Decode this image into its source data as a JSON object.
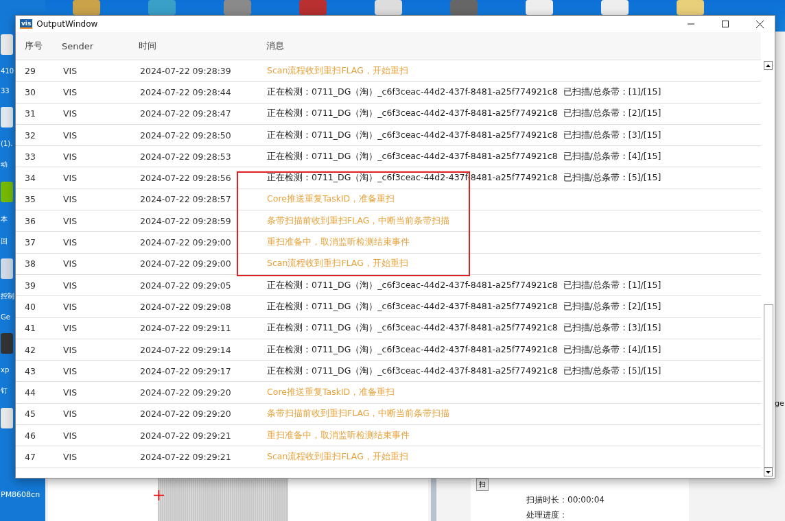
{
  "desktop": {
    "icon_labels": [
      "410",
      "33",
      "(1).",
      "动",
      "本",
      "回",
      "控制",
      "Ge",
      "xp",
      "钉",
      "PM8608cn"
    ]
  },
  "background_app": {
    "duration_label": "扫描时长：00:00:04",
    "progress_label": "处理进度：",
    "button_label": "扫",
    "side_text": "ge"
  },
  "window": {
    "title": "OutputWindow",
    "logo": "vis"
  },
  "table": {
    "columns": [
      "序号",
      "Sender",
      "时间",
      "消息"
    ],
    "rows": [
      {
        "index": "29",
        "sender": "VIS",
        "time": "2024-07-22 09:28:39",
        "message": "Scan流程收到重扫FLAG，开始重扫",
        "kind": "warn"
      },
      {
        "index": "30",
        "sender": "VIS",
        "time": "2024-07-22 09:28:44",
        "message": "正在检测：0711_DG（淘）_c6f3ceac-44d2-437f-8481-a25f774921c8  已扫描/总条带：[1]/[15]",
        "kind": "info"
      },
      {
        "index": "31",
        "sender": "VIS",
        "time": "2024-07-22 09:28:47",
        "message": "正在检测：0711_DG（淘）_c6f3ceac-44d2-437f-8481-a25f774921c8  已扫描/总条带：[2]/[15]",
        "kind": "info"
      },
      {
        "index": "32",
        "sender": "VIS",
        "time": "2024-07-22 09:28:50",
        "message": "正在检测：0711_DG（淘）_c6f3ceac-44d2-437f-8481-a25f774921c8  已扫描/总条带：[3]/[15]",
        "kind": "info"
      },
      {
        "index": "33",
        "sender": "VIS",
        "time": "2024-07-22 09:28:53",
        "message": "正在检测：0711_DG（淘）_c6f3ceac-44d2-437f-8481-a25f774921c8  已扫描/总条带：[4]/[15]",
        "kind": "info"
      },
      {
        "index": "34",
        "sender": "VIS",
        "time": "2024-07-22 09:28:56",
        "message": "正在检测：0711_DG（淘）_c6f3ceac-44d2-437f-8481-a25f774921c8  已扫描/总条带：[5]/[15]",
        "kind": "info"
      },
      {
        "index": "35",
        "sender": "VIS",
        "time": "2024-07-22 09:28:57",
        "message": "Core推送重复TaskID，准备重扫",
        "kind": "warn"
      },
      {
        "index": "36",
        "sender": "VIS",
        "time": "2024-07-22 09:28:59",
        "message": "条带扫描前收到重扫FLAG，中断当前条带扫描",
        "kind": "warn"
      },
      {
        "index": "37",
        "sender": "VIS",
        "time": "2024-07-22 09:29:00",
        "message": "重扫准备中，取消监听检测结束事件",
        "kind": "warn"
      },
      {
        "index": "38",
        "sender": "VIS",
        "time": "2024-07-22 09:29:00",
        "message": "Scan流程收到重扫FLAG，开始重扫",
        "kind": "warn"
      },
      {
        "index": "39",
        "sender": "VIS",
        "time": "2024-07-22 09:29:05",
        "message": "正在检测：0711_DG（淘）_c6f3ceac-44d2-437f-8481-a25f774921c8  已扫描/总条带：[1]/[15]",
        "kind": "info"
      },
      {
        "index": "40",
        "sender": "VIS",
        "time": "2024-07-22 09:29:08",
        "message": "正在检测：0711_DG（淘）_c6f3ceac-44d2-437f-8481-a25f774921c8  已扫描/总条带：[2]/[15]",
        "kind": "info"
      },
      {
        "index": "41",
        "sender": "VIS",
        "time": "2024-07-22 09:29:11",
        "message": "正在检测：0711_DG（淘）_c6f3ceac-44d2-437f-8481-a25f774921c8  已扫描/总条带：[3]/[15]",
        "kind": "info"
      },
      {
        "index": "42",
        "sender": "VIS",
        "time": "2024-07-22 09:29:14",
        "message": "正在检测：0711_DG（淘）_c6f3ceac-44d2-437f-8481-a25f774921c8  已扫描/总条带：[4]/[15]",
        "kind": "info"
      },
      {
        "index": "43",
        "sender": "VIS",
        "time": "2024-07-22 09:29:17",
        "message": "正在检测：0711_DG（淘）_c6f3ceac-44d2-437f-8481-a25f774921c8  已扫描/总条带：[5]/[15]",
        "kind": "info"
      },
      {
        "index": "44",
        "sender": "VIS",
        "time": "2024-07-22 09:29:20",
        "message": "Core推送重复TaskID，准备重扫",
        "kind": "warn"
      },
      {
        "index": "45",
        "sender": "VIS",
        "time": "2024-07-22 09:29:20",
        "message": "条带扫描前收到重扫FLAG，中断当前条带扫描",
        "kind": "warn"
      },
      {
        "index": "46",
        "sender": "VIS",
        "time": "2024-07-22 09:29:21",
        "message": "重扫准备中，取消监听检测结束事件",
        "kind": "warn"
      },
      {
        "index": "47",
        "sender": "VIS",
        "time": "2024-07-22 09:29:21",
        "message": "Scan流程收到重扫FLAG，开始重扫",
        "kind": "warn"
      }
    ]
  }
}
